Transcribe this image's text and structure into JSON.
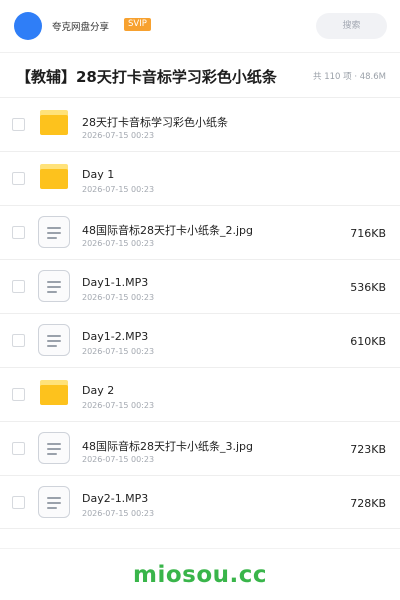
{
  "header": {
    "share_name": "夸克网盘分享",
    "badge": "SVIP",
    "search_placeholder": "搜索",
    "colors": {
      "avatar": "#2f7ef7",
      "badge": "#f7a12f"
    }
  },
  "folder": {
    "title": "【教辅】28天打卡音标学习彩色小纸条",
    "meta": "共 110 项 · 48.6M"
  },
  "files": [
    {
      "type": "folder",
      "icon": "folder-icon",
      "name": "28天打卡音标学习彩色小纸条",
      "date": "2026-07-15 00:23",
      "size": ""
    },
    {
      "type": "folder",
      "icon": "folder-icon",
      "name": "Day 1",
      "date": "2026-07-15 00:23",
      "size": ""
    },
    {
      "type": "file",
      "icon": "document-icon",
      "name": "48国际音标28天打卡小纸条_2.jpg",
      "date": "2026-07-15 00:23",
      "size": "716KB"
    },
    {
      "type": "file",
      "icon": "document-icon",
      "name": "Day1-1.MP3",
      "date": "2026-07-15 00:23",
      "size": "536KB"
    },
    {
      "type": "file",
      "icon": "document-icon",
      "name": "Day1-2.MP3",
      "date": "2026-07-15 00:23",
      "size": "610KB"
    },
    {
      "type": "folder",
      "icon": "folder-icon",
      "name": "Day 2",
      "date": "2026-07-15 00:23",
      "size": ""
    },
    {
      "type": "file",
      "icon": "document-icon",
      "name": "48国际音标28天打卡小纸条_3.jpg",
      "date": "2026-07-15 00:23",
      "size": "723KB"
    },
    {
      "type": "file",
      "icon": "document-icon",
      "name": "Day2-1.MP3",
      "date": "2026-07-15 00:23",
      "size": "728KB"
    }
  ],
  "watermark": "miosou.cc"
}
